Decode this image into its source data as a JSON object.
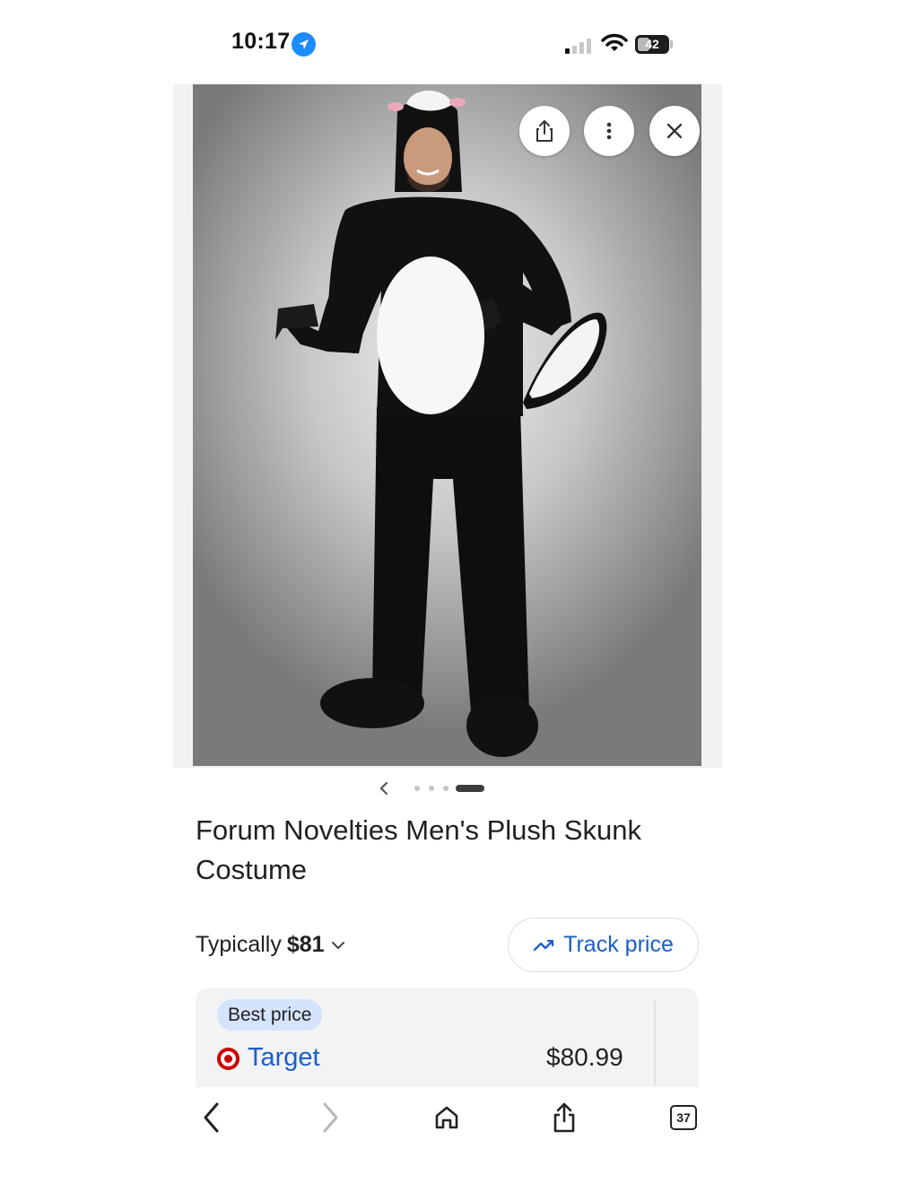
{
  "status_bar": {
    "time": "10:17",
    "battery_level": "42",
    "location_icon": "location-arrow-icon",
    "signal_icon": "cellular-signal-icon",
    "wifi_icon": "wifi-icon"
  },
  "image_viewer": {
    "share_icon": "share-icon",
    "more_icon": "more-vertical-icon",
    "close_icon": "close-icon",
    "carousel": {
      "prev_icon": "chevron-left-icon",
      "total_dots": 4,
      "active_index": 3
    }
  },
  "product": {
    "title": "Forum Novelties Men's Plush Skunk Costume",
    "typically_label": "Typically",
    "typical_price": "$81",
    "expand_icon": "chevron-down-icon",
    "track_price_label": "Track price",
    "track_icon": "trending-icon"
  },
  "offer": {
    "badge": "Best price",
    "merchant": "Target",
    "merchant_logo": "target-logo-icon",
    "price": "$80.99"
  },
  "toolbar": {
    "back_icon": "back-icon",
    "forward_icon": "forward-icon",
    "home_icon": "home-icon",
    "share_icon": "share-icon",
    "tabs_count": "37"
  },
  "colors": {
    "accent": "#1a5ec9",
    "badge_bg": "#d5e3fc",
    "card_bg": "#f1f3f4",
    "target_red": "#cc0000"
  }
}
